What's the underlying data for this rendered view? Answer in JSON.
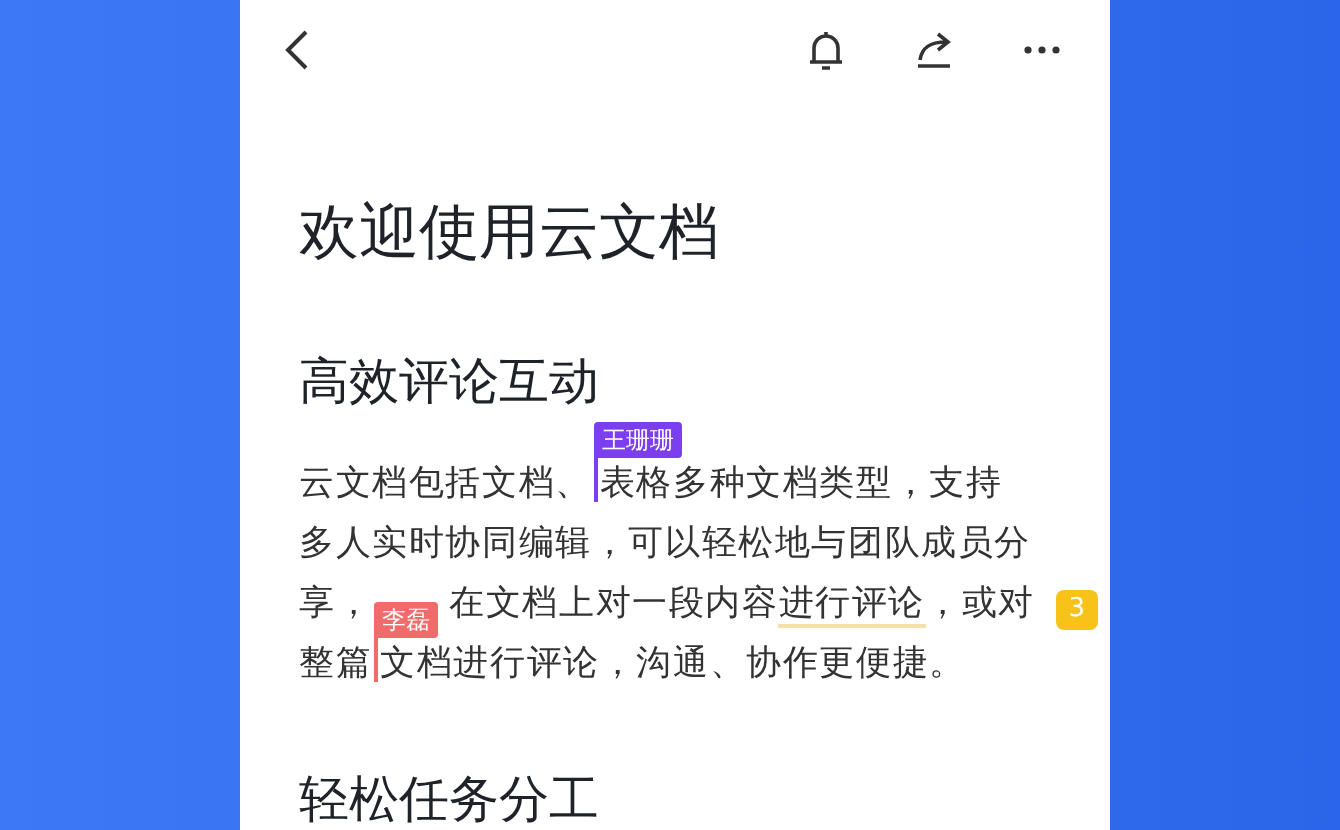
{
  "title": "欢迎使用云文档",
  "sections": [
    {
      "heading": "高效评论互动",
      "comment_count": "3",
      "paragraph": [
        {
          "kind": "text",
          "text": "云文档包括文档、"
        },
        {
          "kind": "cursor",
          "user": "王珊珊",
          "color": "#7b3ff0"
        },
        {
          "kind": "text",
          "text": "表格多种文档类型，支持多人实时协同编辑，可以轻松地与团队成员分享，"
        },
        {
          "kind": "gap"
        },
        {
          "kind": "text",
          "text": "在文档上对一段内容"
        },
        {
          "kind": "comment",
          "text": "进行评论"
        },
        {
          "kind": "text",
          "text": "，或对整篇"
        },
        {
          "kind": "cursor",
          "user": "李磊",
          "color": "#f26b6b"
        },
        {
          "kind": "text",
          "text": "文档进行评论，沟通、协作更便捷。"
        }
      ]
    },
    {
      "heading": "轻松任务分工"
    }
  ]
}
